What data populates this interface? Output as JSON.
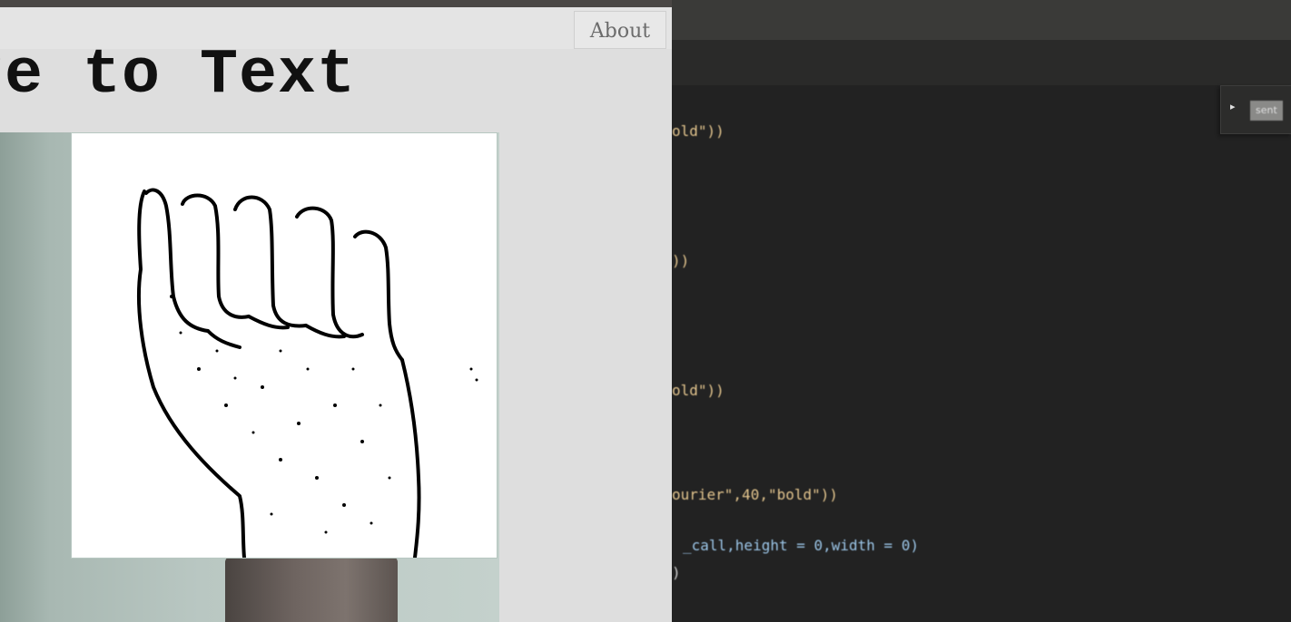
{
  "app": {
    "title": "ge to Text",
    "about_button": "About"
  },
  "editor": {
    "minimap_arrow": "▸",
    "minimap_label": "sent",
    "code_lines": [
      {
        "text": "old\"))"
      },
      {
        "text": "))"
      },
      {
        "text": "old\"))"
      },
      {
        "text": "ourier\",40,\"bold\"))"
      },
      {
        "text": "_call,height = 0,width = 0)"
      },
      {
        "text": ")"
      }
    ]
  }
}
